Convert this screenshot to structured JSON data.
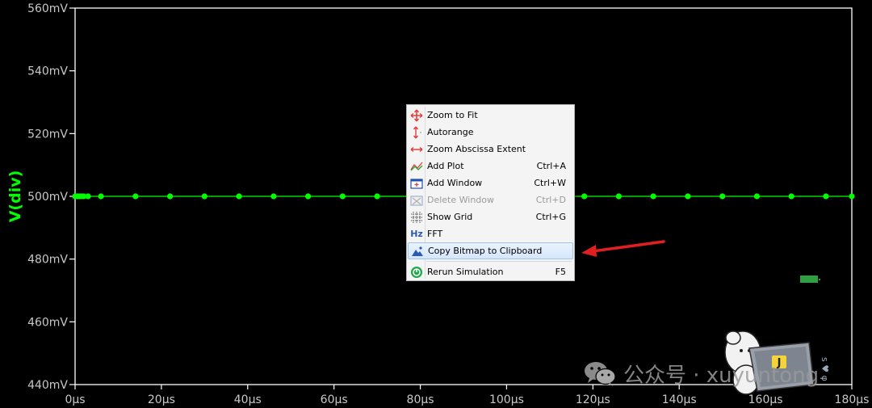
{
  "chart_data": {
    "type": "line",
    "ylabel": "V(div)",
    "xlabel": "",
    "ylim": [
      440,
      560
    ],
    "xlim": [
      0,
      180
    ],
    "y_ticks": [
      "560mV",
      "540mV",
      "520mV",
      "500mV",
      "480mV",
      "460mV",
      "440mV"
    ],
    "y_tick_values": [
      560,
      540,
      520,
      500,
      480,
      460,
      440
    ],
    "x_ticks": [
      "0µs",
      "20µs",
      "40µs",
      "60µs",
      "80µs",
      "100µs",
      "120µs",
      "140µs",
      "160µs",
      "180µs"
    ],
    "x_tick_values": [
      0,
      20,
      40,
      60,
      80,
      100,
      120,
      140,
      160,
      180
    ],
    "series": [
      {
        "color": "#00ff00",
        "x": [
          0,
          0.5,
          1,
          1.5,
          2,
          3,
          6,
          14,
          22,
          30,
          38,
          46,
          54,
          62,
          70,
          78,
          86,
          94,
          102,
          110,
          118,
          126,
          134,
          142,
          150,
          158,
          166,
          174,
          180
        ],
        "y": [
          500,
          500,
          500,
          500,
          500,
          500,
          500,
          500,
          500,
          500,
          500,
          500,
          500,
          500,
          500,
          500,
          500,
          500,
          500,
          500,
          500,
          500,
          500,
          500,
          500,
          500,
          500,
          500,
          500
        ]
      }
    ]
  },
  "context_menu": {
    "items": [
      {
        "label": "Zoom to Fit",
        "shortcut": "",
        "icon": "zoom-fit-icon",
        "enabled": true
      },
      {
        "label": "Autorange",
        "shortcut": "",
        "icon": "autorange-icon",
        "enabled": true
      },
      {
        "label": "Zoom Abscissa Extent",
        "shortcut": "",
        "icon": "zoom-abscissa-icon",
        "enabled": true
      },
      {
        "label": "Add Plot",
        "shortcut": "Ctrl+A",
        "icon": "add-plot-icon",
        "enabled": true
      },
      {
        "label": "Add Window",
        "shortcut": "Ctrl+W",
        "icon": "add-window-icon",
        "enabled": true
      },
      {
        "label": "Delete Window",
        "shortcut": "Ctrl+D",
        "icon": "delete-window-icon",
        "enabled": false
      },
      {
        "label": "Show Grid",
        "shortcut": "Ctrl+G",
        "icon": "grid-icon",
        "enabled": true
      },
      {
        "label": "FFT",
        "shortcut": "",
        "icon": "fft-icon",
        "enabled": true
      },
      {
        "label": "Copy Bitmap to Clipboard",
        "shortcut": "",
        "icon": "copy-bitmap-icon",
        "enabled": true,
        "highlighted": true
      },
      {
        "label": "Rerun Simulation",
        "shortcut": "F5",
        "icon": "rerun-icon",
        "enabled": true
      }
    ],
    "fft_icon_text": "Hz"
  },
  "watermark": {
    "text": "公众号 · xuyuntong",
    "mascot_badge": "J",
    "side_glyphs": "s ♥ φ"
  },
  "colors": {
    "trace": "#00ff00",
    "axis": "#ffffff",
    "arrow": "#e02020",
    "menu_highlight": "#d5e6fb"
  }
}
